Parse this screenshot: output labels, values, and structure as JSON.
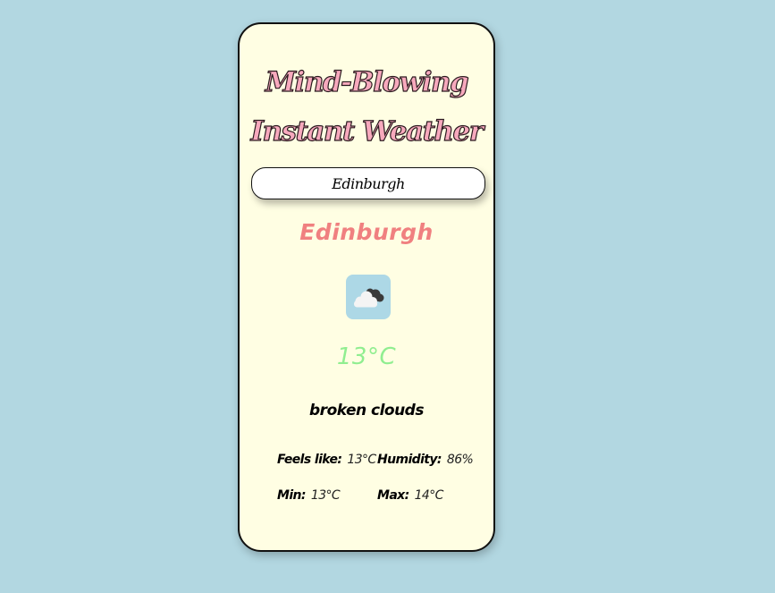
{
  "app": {
    "title_line1": "Mind-Blowing",
    "title_line2": "Instant Weather"
  },
  "search": {
    "value": "Edinburgh",
    "placeholder": ""
  },
  "weather": {
    "city": "Edinburgh",
    "icon": "broken-clouds-icon",
    "temperature": "13°C",
    "description": "broken clouds",
    "feels_like_label": "Feels like:",
    "feels_like_value": "13°C",
    "humidity_label": "Humidity:",
    "humidity_value": "86%",
    "min_label": "Min:",
    "min_value": "13°C",
    "max_label": "Max:",
    "max_value": "14°C"
  },
  "colors": {
    "background": "#b2d7e1",
    "card": "#fffee3",
    "title": "#f7a9bd",
    "city": "#f08080",
    "temperature": "#90ee90",
    "icon_background": "#add8e6"
  }
}
